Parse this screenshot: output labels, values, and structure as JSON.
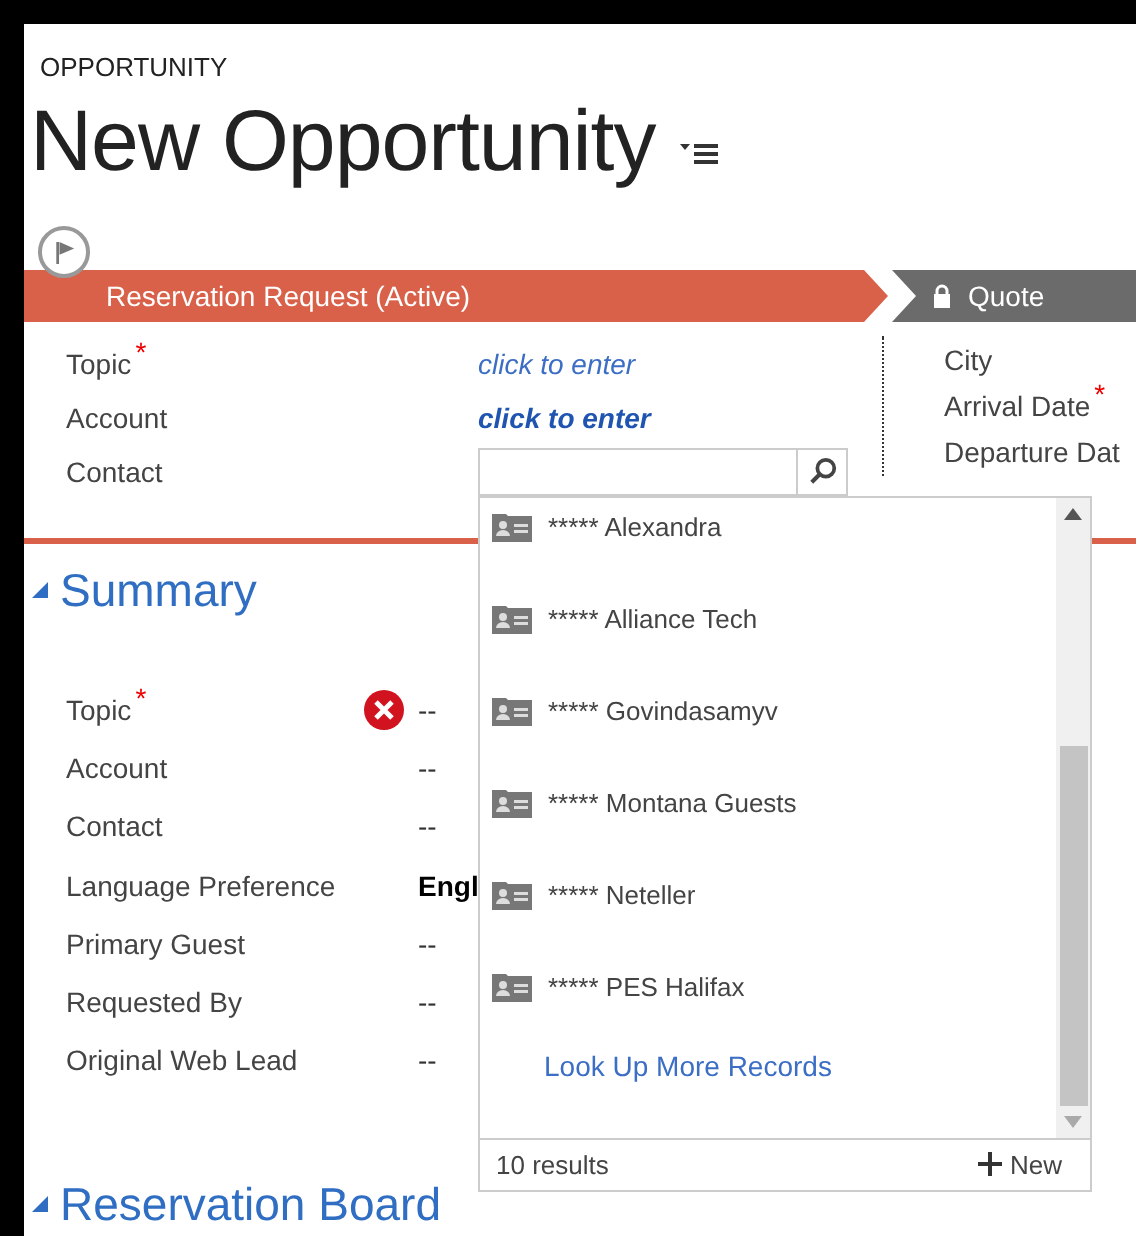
{
  "entity_label": "OPPORTUNITY",
  "title": "New Opportunity",
  "stages": [
    {
      "label": "Reservation Request (Active)",
      "selected": true,
      "locked": false
    },
    {
      "label": "Quote",
      "selected": false,
      "locked": true
    }
  ],
  "header_fields": {
    "left": [
      {
        "label": "Topic",
        "required_mark": "*",
        "kind": "text",
        "value": "click to enter"
      },
      {
        "label": "Account",
        "kind": "bold",
        "value": "click to enter"
      },
      {
        "label": "Contact",
        "kind": "lookup"
      }
    ],
    "right": [
      {
        "label": "City"
      },
      {
        "label": "Arrival Date",
        "required_mark": "*"
      },
      {
        "label": "Departure Dat"
      }
    ]
  },
  "lookup": {
    "results": [
      "***** Alexandra",
      "***** Alliance Tech",
      "***** Govindasamyv",
      "***** Montana Guests",
      "***** Neteller",
      "***** PES Halifax"
    ],
    "more_link": "Look Up More Records",
    "count": "10 results",
    "new_button": "New"
  },
  "sections": [
    {
      "title": "Summary",
      "expanded": true,
      "fields": [
        {
          "label": "Topic",
          "required_mark": "*",
          "error": true,
          "bold": false,
          "value": "--"
        },
        {
          "label": "Account",
          "error": false,
          "bold": false,
          "value": "--"
        },
        {
          "label": "Contact",
          "error": false,
          "bold": false,
          "value": "--"
        },
        {
          "label": "Language Preference",
          "error": false,
          "bold": true,
          "value": "Engl"
        },
        {
          "label": "Primary Guest",
          "error": false,
          "bold": false,
          "value": "--"
        },
        {
          "label": "Requested By",
          "error": false,
          "bold": false,
          "value": "--"
        },
        {
          "label": "Original Web Lead",
          "error": false,
          "bold": false,
          "value": "--"
        }
      ]
    },
    {
      "title": "Reservation Board",
      "expanded": true
    }
  ]
}
